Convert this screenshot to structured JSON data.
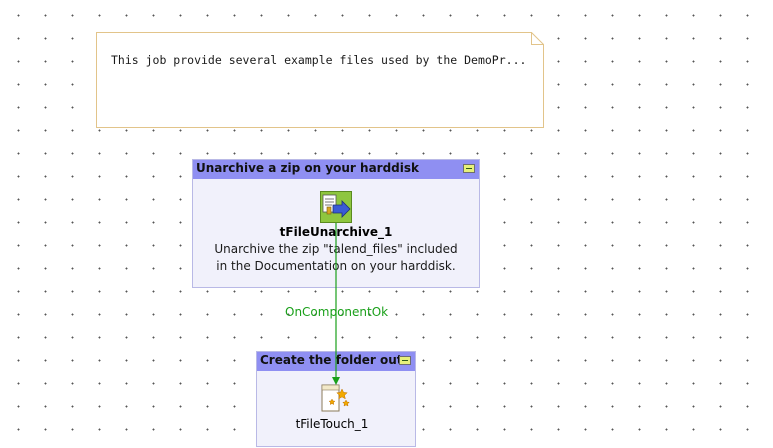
{
  "note": {
    "text": "This job provide several example files used by the DemoPr..."
  },
  "subjobs": [
    {
      "title": "Unarchive a zip on your harddisk",
      "component": {
        "name": "tFileUnarchive_1",
        "icon": "file-unarchive-icon",
        "description_line1": "Unarchive the zip \"talend_files\" included",
        "description_line2": "in the Documentation on your harddisk."
      }
    },
    {
      "title": "Create the folder out",
      "component": {
        "name": "tFileTouch_1",
        "icon": "file-touch-icon"
      }
    }
  ],
  "connection": {
    "label": "OnComponentOk",
    "color": "#1aa01a"
  },
  "colors": {
    "subjob_header": "#8f8ff2",
    "subjob_body": "#f1f1fb",
    "note_border": "#e2c48a",
    "collapse_button": "#e6f07a"
  }
}
